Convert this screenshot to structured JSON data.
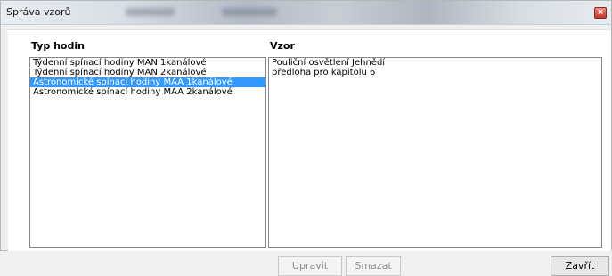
{
  "window": {
    "title": "Správa vzorů",
    "close_symbol": "×"
  },
  "panels": {
    "left_header": "Typ hodin",
    "right_header": "Vzor"
  },
  "clock_types": [
    {
      "label": "Týdenní spínací hodiny MAN 1kanálové",
      "selected": false
    },
    {
      "label": "Týdenní spínací hodiny MAN 2kanálové",
      "selected": false
    },
    {
      "label": "Astronomické spínací hodiny MAA 1kanálové",
      "selected": true
    },
    {
      "label": "Astronomické spínací hodiny MAA 2kanálové",
      "selected": false
    }
  ],
  "templates": [
    "Pouliční osvětlení Jehnědí",
    "předloha pro kapitolu 6"
  ],
  "buttons": {
    "edit": "Upravit",
    "delete": "Smazat",
    "close": "Zavřít"
  },
  "colors": {
    "selection": "#3399ff",
    "close_button": "#c4392a"
  }
}
